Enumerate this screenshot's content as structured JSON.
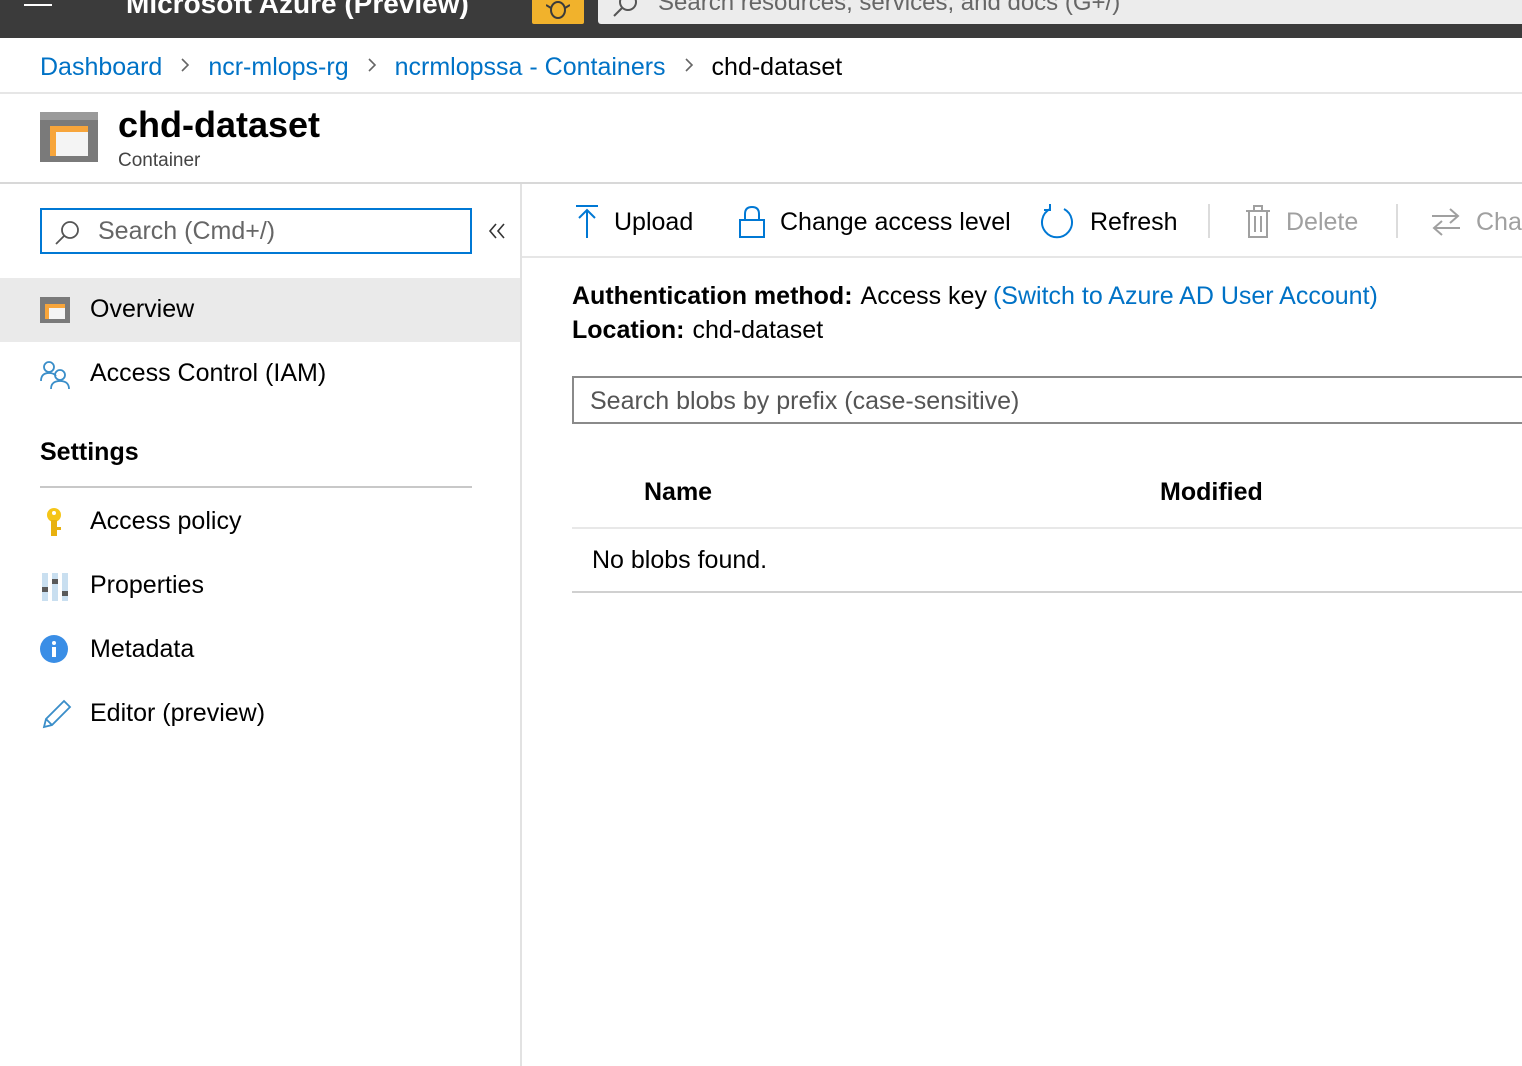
{
  "header": {
    "app_title": "Microsoft Azure (Preview)",
    "search_placeholder": "Search resources, services, and docs (G+/)",
    "feedback_icon": "bug-icon",
    "menu_icon": "hamburger-icon"
  },
  "breadcrumb": {
    "items": [
      "Dashboard",
      "ncr-mlops-rg",
      "ncrmlopssa - Containers"
    ],
    "current": "chd-dataset"
  },
  "resource": {
    "title": "chd-dataset",
    "subtitle": "Container",
    "icon": "container-icon"
  },
  "leftnav": {
    "search_placeholder": "Search (Cmd+/)",
    "collapse_icon": "double-chevron-left-icon",
    "items": [
      {
        "label": "Overview",
        "icon": "container-icon",
        "selected": true
      },
      {
        "label": "Access Control (IAM)",
        "icon": "people-icon",
        "selected": false
      }
    ],
    "section_title": "Settings",
    "settings_items": [
      {
        "label": "Access policy",
        "icon": "key-icon"
      },
      {
        "label": "Properties",
        "icon": "sliders-icon"
      },
      {
        "label": "Metadata",
        "icon": "info-icon"
      },
      {
        "label": "Editor (preview)",
        "icon": "pencil-icon"
      }
    ]
  },
  "commandbar": {
    "upload": "Upload",
    "change_access_level": "Change access level",
    "refresh": "Refresh",
    "delete": "Delete",
    "change_tier": "Cha"
  },
  "content": {
    "auth_method_label": "Authentication method:",
    "auth_method_value": "Access key",
    "auth_switch_link": "(Switch to Azure AD User Account)",
    "location_label": "Location:",
    "location_value": "chd-dataset",
    "blob_search_placeholder": "Search blobs by prefix (case-sensitive)",
    "columns": [
      "Name",
      "Modified"
    ],
    "empty_message": "No blobs found."
  },
  "colors": {
    "accent": "#0078d4",
    "link": "#0072c6",
    "topbar": "#3b3b3b",
    "feedback": "#f1b22c"
  }
}
